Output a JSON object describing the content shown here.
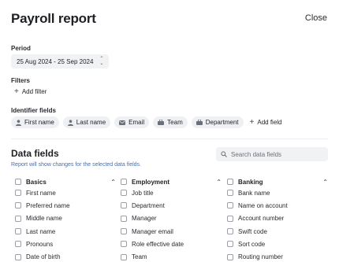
{
  "header": {
    "title": "Payroll report",
    "close_label": "Close"
  },
  "period": {
    "label": "Period",
    "value": "25 Aug 2024 - 25 Sep 2024",
    "arrows": "⌃⌄"
  },
  "filters": {
    "label": "Filters",
    "add_label": "Add filter"
  },
  "identifier": {
    "label": "Identifier fields",
    "chips": [
      {
        "label": "First name",
        "icon": "person-icon"
      },
      {
        "label": "Last name",
        "icon": "person-icon"
      },
      {
        "label": "Email",
        "icon": "email-icon"
      },
      {
        "label": "Team",
        "icon": "team-icon"
      },
      {
        "label": "Department",
        "icon": "department-icon"
      }
    ],
    "add_label": "Add field"
  },
  "data_fields": {
    "title": "Data fields",
    "subtitle": "Report will show changes for the selected data fields.",
    "search_placeholder": "Search data fields",
    "columns": [
      {
        "title": "Basics",
        "items": [
          "First name",
          "Preferred name",
          "Middle name",
          "Last name",
          "Pronouns",
          "Date of birth"
        ]
      },
      {
        "title": "Employment",
        "items": [
          "Job title",
          "Department",
          "Manager",
          "Manager email",
          "Role effective date",
          "Team"
        ]
      },
      {
        "title": "Banking",
        "items": [
          "Bank name",
          "Name on account",
          "Account number",
          "Swift code",
          "Sort code",
          "Routing number"
        ]
      }
    ]
  }
}
